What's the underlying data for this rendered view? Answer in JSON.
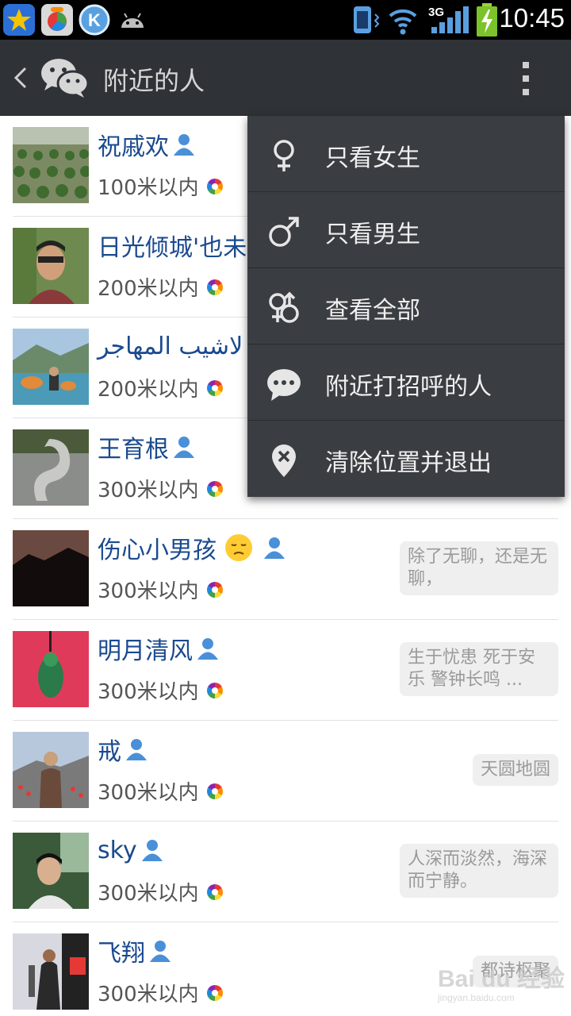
{
  "status_bar": {
    "time": "10:45",
    "network": "3G"
  },
  "action_bar": {
    "title": "附近的人"
  },
  "menu": {
    "items": [
      {
        "label": "只看女生",
        "icon": "female-icon"
      },
      {
        "label": "只看男生",
        "icon": "male-icon"
      },
      {
        "label": "查看全部",
        "icon": "all-genders-icon"
      },
      {
        "label": "附近打招呼的人",
        "icon": "chat-bubble-icon"
      },
      {
        "label": "清除位置并退出",
        "icon": "clear-location-icon"
      }
    ]
  },
  "people": [
    {
      "name": "祝戚欢",
      "distance": "100米以内",
      "signature": ""
    },
    {
      "name": "日光倾城'也未",
      "distance": "200米以内",
      "signature": ""
    },
    {
      "name": "لاشيب المهاجر",
      "distance": "200米以内",
      "signature": ""
    },
    {
      "name": "王育根",
      "distance": "300米以内",
      "signature": ""
    },
    {
      "name": "伤心小男孩",
      "distance": "300米以内",
      "signature": "除了无聊，还是无聊，"
    },
    {
      "name": "明月清风",
      "distance": "300米以内",
      "signature": "生于忧患 死于安乐 警钟长鸣 ..."
    },
    {
      "name": "戒",
      "distance": "300米以内",
      "signature": "天圆地圆"
    },
    {
      "name": "sky",
      "distance": "300米以内",
      "signature": "人深而淡然，海深而宁静。"
    },
    {
      "name": "飞翔",
      "distance": "300米以内",
      "signature": "都诗枢聚"
    }
  ],
  "watermark": {
    "brand": "Bai du 经验",
    "url": "jingyan.baidu.com"
  },
  "colors": {
    "name": "#1a4a8f",
    "action_bar": "#2f3236",
    "menu": "#3a3d41"
  }
}
